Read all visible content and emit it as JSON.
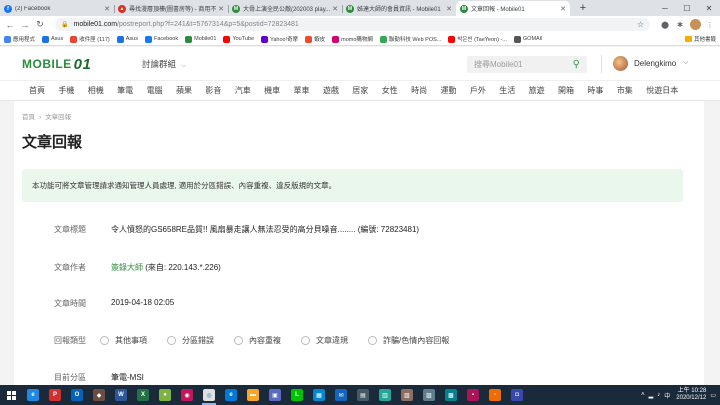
{
  "browser": {
    "tabs": [
      {
        "title": "(2) Facebook",
        "fav_color": "#1877f2",
        "fav_glyph": "f",
        "active": false
      },
      {
        "title": "尋找漫層頂樓(圖書房等) - 商用不",
        "fav_color": "#d93025",
        "fav_glyph": "▲",
        "active": false
      },
      {
        "title": "大骨上演全民公敵(202003 play...",
        "fav_color": "#2a8c3c",
        "fav_glyph": "M",
        "active": false
      },
      {
        "title": "姊達大師的會員資訊 - Mobile01",
        "fav_color": "#2a8c3c",
        "fav_glyph": "M",
        "active": false
      },
      {
        "title": "文章回報 - Mobile01",
        "fav_color": "#2a8c3c",
        "fav_glyph": "M",
        "active": true
      }
    ],
    "newtab": "+",
    "window_controls": [
      "─",
      "☐",
      "✕"
    ],
    "url_host": "mobile01.com",
    "url_path": "/postreport.php?f=241&t=5767314&p=5&postid=72823481",
    "lock_glyph": "🔒",
    "bookmarks": [
      {
        "label": "應用程式",
        "color": "#4285f4"
      },
      {
        "label": "Asus",
        "color": "#1a73e8"
      },
      {
        "label": "收件匣 (117)",
        "color": "#ea4335"
      },
      {
        "label": "Asus",
        "color": "#1a73e8"
      },
      {
        "label": "Facebook",
        "color": "#1877f2"
      },
      {
        "label": "Mobile01",
        "color": "#2a8c3c"
      },
      {
        "label": "YouTube",
        "color": "#ff0000"
      },
      {
        "label": "Yahoo!奇摩",
        "color": "#6001d2"
      },
      {
        "label": "蝦皮",
        "color": "#ee4d2d"
      },
      {
        "label": "momo購物網",
        "color": "#d6006e"
      },
      {
        "label": "聯勤科技 Web POS...",
        "color": "#34a853"
      },
      {
        "label": "박은빈 (TaeYeon) -...",
        "color": "#ff0000"
      },
      {
        "label": "GOMAll",
        "color": "#555555"
      }
    ],
    "bookmarks_other": "其他書籤"
  },
  "site": {
    "logo_text": "MOBILE",
    "logo_num": "01",
    "forum_group": "討論群組",
    "search_placeholder": "搜尋Mobile01",
    "username": "Delengkimo",
    "categories": [
      "首頁",
      "手機",
      "相機",
      "筆電",
      "電腦",
      "蘋果",
      "影音",
      "汽車",
      "機車",
      "單車",
      "遊戲",
      "居家",
      "女性",
      "時尚",
      "運動",
      "戶外",
      "生活",
      "旅遊",
      "開箱",
      "時事",
      "市集",
      "悅遊日本"
    ]
  },
  "page": {
    "breadcrumb": [
      "首頁",
      "文章回報"
    ],
    "title": "文章回報",
    "notice": "本功能可將文章管理請求通知管理人員處理, 適用於分區錯誤、內容重複、違反版規的文章。",
    "article_title_label": "文章標題",
    "article_title_value": "令人憤怒的GS658RE品質!! 風扇暴走讓人無法忍受的高分貝噪音........ (編號: 72823481)",
    "author_label": "文章作者",
    "author_name": "簽錄大師",
    "author_ip": " (來自: 220.143.*.226)",
    "time_label": "文章時間",
    "time_value": "2019-04-18 02:05",
    "report_type_label": "回報類型",
    "report_types": [
      "其他事項",
      "分區錯誤",
      "內容重複",
      "文章違規",
      "詐騙/色情內容回報"
    ],
    "current_forum_label": "目前分區",
    "current_forum_value": "筆電-MSI"
  },
  "taskbar": {
    "apps": [
      {
        "name": "ie",
        "color": "#1e88e5",
        "glyph": "e",
        "open": false
      },
      {
        "name": "pdf",
        "color": "#d32f2f",
        "glyph": "P",
        "open": false
      },
      {
        "name": "outlook",
        "color": "#0364b8",
        "glyph": "O",
        "open": false
      },
      {
        "name": "game",
        "color": "#6d4c41",
        "glyph": "◆",
        "open": false
      },
      {
        "name": "word",
        "color": "#2b579a",
        "glyph": "W",
        "open": false
      },
      {
        "name": "excel",
        "color": "#217346",
        "glyph": "X",
        "open": false
      },
      {
        "name": "media",
        "color": "#7cb342",
        "glyph": "●",
        "open": false
      },
      {
        "name": "photos",
        "color": "#c2185b",
        "glyph": "◉",
        "open": false
      },
      {
        "name": "chrome",
        "color": "#e0e0e0",
        "glyph": "◎",
        "open": true
      },
      {
        "name": "edge",
        "color": "#0078d7",
        "glyph": "e",
        "open": false
      },
      {
        "name": "explorer",
        "color": "#f9a825",
        "glyph": "▬",
        "open": false
      },
      {
        "name": "store",
        "color": "#5c6bc0",
        "glyph": "▣",
        "open": false
      },
      {
        "name": "line",
        "color": "#00c300",
        "glyph": "L",
        "open": false
      },
      {
        "name": "calendar",
        "color": "#0288d1",
        "glyph": "▦",
        "open": false
      },
      {
        "name": "mail",
        "color": "#1565c0",
        "glyph": "✉",
        "open": false
      },
      {
        "name": "app16",
        "color": "#455a64",
        "glyph": "▤",
        "open": false
      },
      {
        "name": "app17",
        "color": "#26a69a",
        "glyph": "▥",
        "open": false
      },
      {
        "name": "app18",
        "color": "#8d6e63",
        "glyph": "▧",
        "open": false
      },
      {
        "name": "app19",
        "color": "#607d8b",
        "glyph": "▨",
        "open": false
      },
      {
        "name": "app20",
        "color": "#00838f",
        "glyph": "▩",
        "open": false
      },
      {
        "name": "app21",
        "color": "#ad1457",
        "glyph": "▪",
        "open": false
      },
      {
        "name": "app22",
        "color": "#ef6c00",
        "glyph": "▫",
        "open": false
      },
      {
        "name": "app23",
        "color": "#3949ab",
        "glyph": "◘",
        "open": false
      }
    ],
    "clock_time": "上午 10:28",
    "clock_date": "2020/12/12"
  }
}
